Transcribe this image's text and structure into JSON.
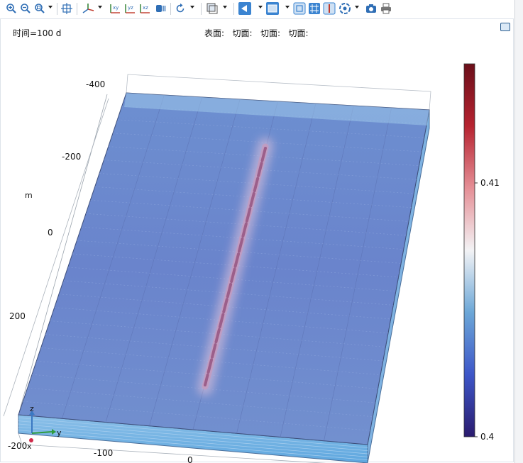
{
  "toolbar": {
    "tools": [
      {
        "name": "zoom-in-icon"
      },
      {
        "name": "zoom-out-icon"
      },
      {
        "name": "zoom-box-icon"
      },
      {
        "name": "zoom-extents-icon"
      },
      {
        "name": "axes-orientation-icon"
      },
      {
        "name": "view-xy-icon",
        "label": "xy"
      },
      {
        "name": "view-yz-icon",
        "label": "yz"
      },
      {
        "name": "view-xz-icon",
        "label": "xz"
      },
      {
        "name": "headlight-icon"
      },
      {
        "name": "rotate-icon"
      },
      {
        "name": "transparency-icon"
      },
      {
        "name": "scene-light-icon"
      },
      {
        "name": "wireframe-icon"
      },
      {
        "name": "render-icon"
      },
      {
        "name": "grid-icon"
      },
      {
        "name": "axis-icon"
      },
      {
        "name": "reset-hiding-icon"
      },
      {
        "name": "camera-icon"
      },
      {
        "name": "print-icon"
      }
    ]
  },
  "plot": {
    "time_label": "时间=100 d",
    "subtitle": "表面:   切面:   切面:   切面:",
    "unit_label": "m",
    "axis_labels_left": [
      "-400",
      "-200",
      "0",
      "200"
    ],
    "axis_labels_bottom": [
      "-200",
      "-100",
      "0"
    ],
    "triad": {
      "z": "z",
      "y": "y",
      "x": "x"
    },
    "colorbar": {
      "max_label": "0.41",
      "min_label": "0.4",
      "colors": [
        "#6b0f1a",
        "#b62330",
        "#e58f96",
        "#f3f3f5",
        "#6ca7d7",
        "#3d56c8",
        "#2a1b6e"
      ]
    }
  }
}
